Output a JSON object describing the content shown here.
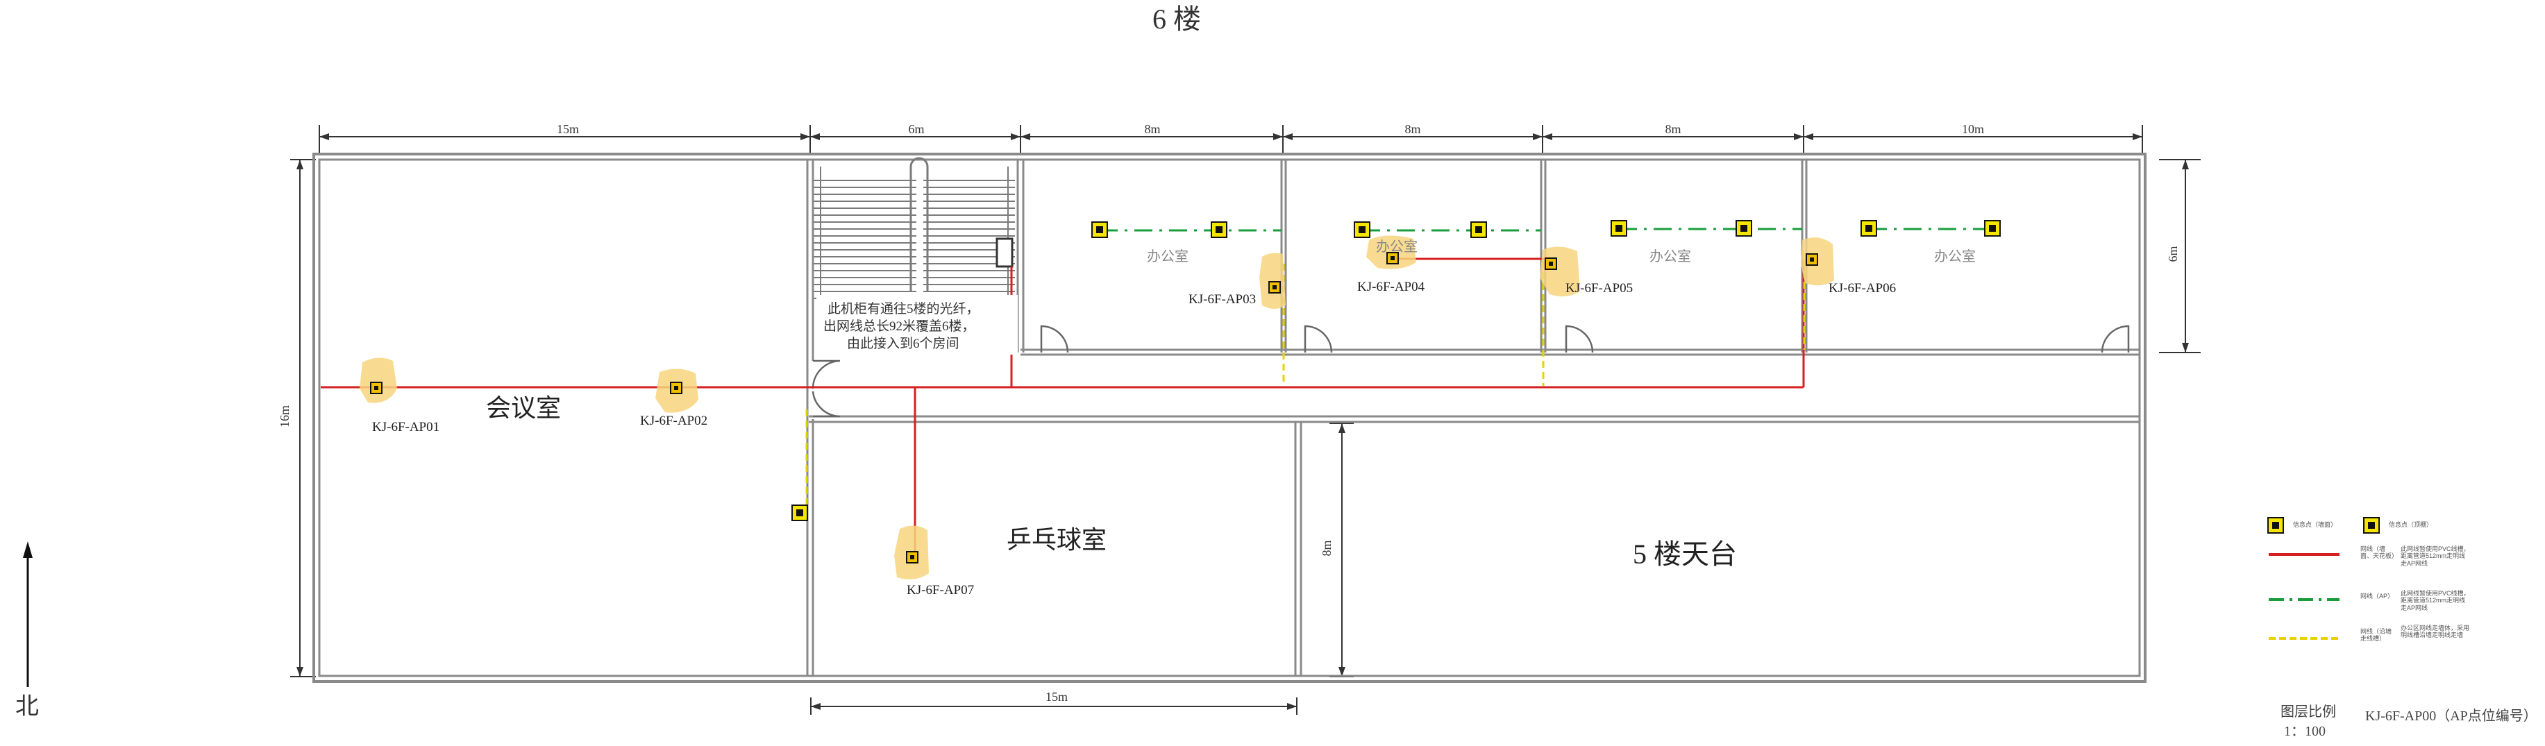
{
  "title": "6 楼",
  "dimensions": {
    "top": [
      "15m",
      "6m",
      "8m",
      "8m",
      "8m",
      "10m"
    ],
    "left": "16m",
    "right": "6m",
    "bottom": "15m",
    "inner": "8m"
  },
  "rooms": {
    "meeting": "会议室",
    "pingpong": "乒乓球室",
    "terrace": "5 楼天台",
    "office": "办公室"
  },
  "note": [
    "此机柜有通往5楼的光纤，",
    "出网线总长92米覆盖6楼，",
    "由此接入到6个房间"
  ],
  "access_points": [
    "KJ-6F-AP01",
    "KJ-6F-AP02",
    "KJ-6F-AP03",
    "KJ-6F-AP04",
    "KJ-6F-AP05",
    "KJ-6F-AP06",
    "KJ-6F-AP07"
  ],
  "legend": {
    "info_point_wall": "信息点（墙面）",
    "info_point_ceiling": "信息点（顶棚）",
    "cable_red": "网线（墙面、天花板）",
    "cable_red_note": "此网线暂使用PVC线槽，距离管道512mm走明线走AP网线",
    "cable_green": "网线（AP）",
    "cable_green_note": "此网线暂使用PVC线槽，距离管道512mm走明线走AP网线",
    "cable_yellow": "网线（沿墙走线槽）",
    "cable_yellow_note": "办公区网线走墙体，采用明线槽沿墙走明线走墙"
  },
  "scale": {
    "label": "图层比例",
    "value": "1：100"
  },
  "ap_label_note": "KJ-6F-AP00（AP点位编号）",
  "north": "北",
  "colors": {
    "wall": "#888888",
    "red_cable": "#d42020",
    "green_cable": "#1a9c3c",
    "yellow_cable": "#e8d200",
    "ap_glow": "#f7d57e"
  }
}
